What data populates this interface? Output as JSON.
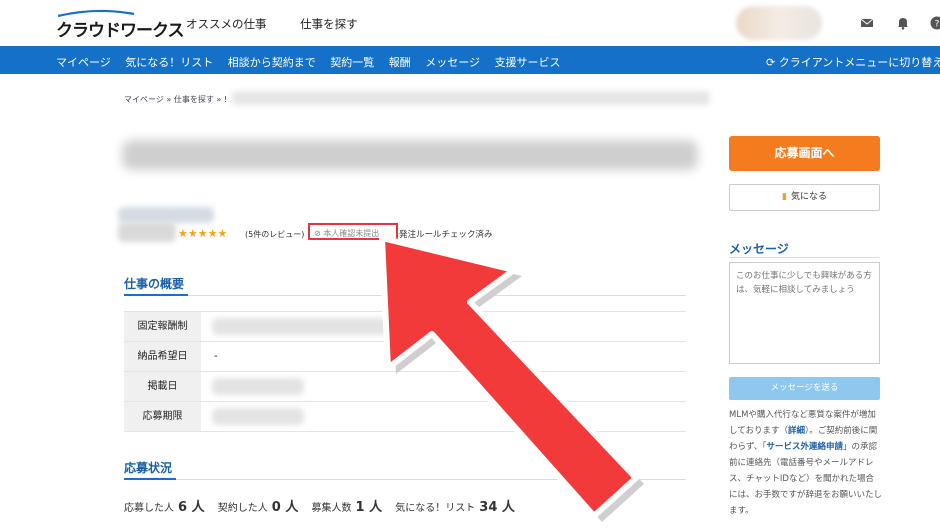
{
  "header": {
    "logo_text": "クラウドワークス",
    "top_nav": [
      "オススメの仕事",
      "仕事を探す"
    ],
    "icons": [
      "mail-icon",
      "bell-icon",
      "help-icon"
    ]
  },
  "main_nav": {
    "items": [
      "マイページ",
      "気になる！リスト",
      "相談から契約まで",
      "契約一覧",
      "報酬",
      "メッセージ",
      "支援サービス"
    ],
    "client_switch": "クライアントメニューに切り替え"
  },
  "breadcrumb": {
    "items": [
      "マイページ",
      "»",
      "仕事を探す",
      "»",
      "!"
    ]
  },
  "client_info": {
    "stars": "★★★★★",
    "reviews": "(5件のレビュー)",
    "id_status": "本人確認未提出",
    "rule_check": "発注ルールチェック済み"
  },
  "overview": {
    "title": "仕事の概要",
    "rows": [
      {
        "label": "固定報酬制",
        "value": ""
      },
      {
        "label": "納品希望日",
        "value": "-"
      },
      {
        "label": "掲載日",
        "value": ""
      },
      {
        "label": "応募期限",
        "value": ""
      }
    ]
  },
  "status": {
    "title": "応募状況",
    "applied_label": "応募した人",
    "applied_value": "6 人",
    "contracted_label": "契約した人",
    "contracted_value": "0 人",
    "recruit_label": "募集人数",
    "recruit_value": "1 人",
    "fav_label": "気になる！リスト",
    "fav_value": "34 人"
  },
  "sidebar": {
    "apply_label": "応募画面へ",
    "fav_label": "気になる",
    "message_title": "メッセージ",
    "message_placeholder": "このお仕事に少しでも興味がある方は、気軽に相談してみましょう",
    "send_label": "メッセージを送る",
    "notice_1": "MLMや購入代行など悪質な案件が増加しております（",
    "notice_link_1": "詳細",
    "notice_2": "）。ご契約前後に関わらず、「",
    "notice_link_2": "サービス外連絡申請",
    "notice_3": "」の承認前に連絡先（電話番号やメールアドレス、チャットIDなど）を聞かれた場合には、お手数ですが辞退をお願いいたします。"
  },
  "colors": {
    "nav_blue": "#1570c8",
    "apply_orange": "#f47c1e",
    "arrow_red": "#f23a3a",
    "highlight_red": "#e8343a"
  }
}
